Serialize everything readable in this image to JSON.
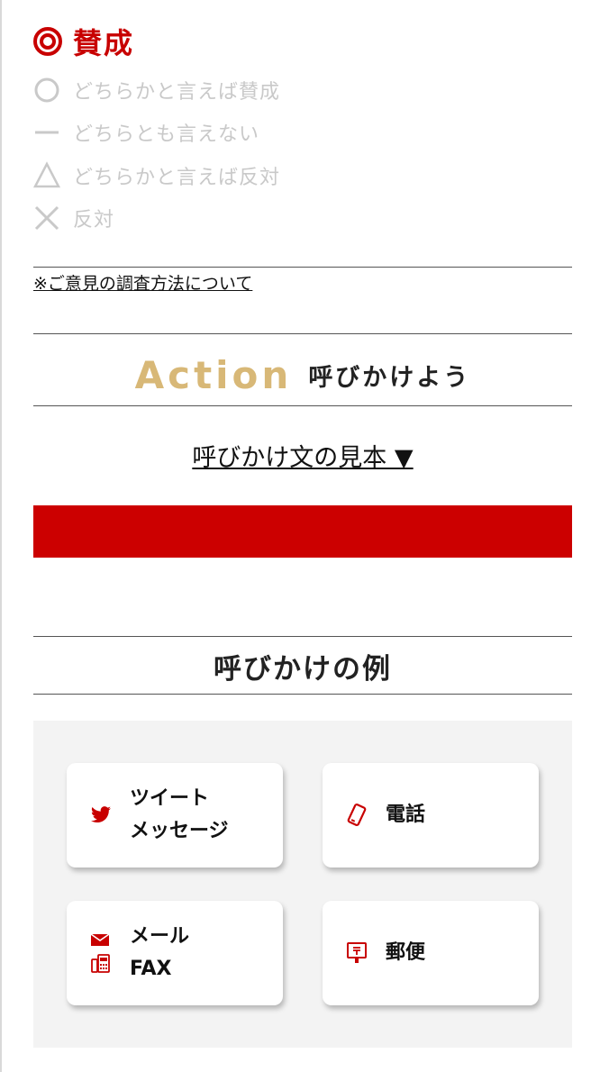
{
  "legend": {
    "strong_agree": "賛成",
    "agree": "どちらかと言えば賛成",
    "neutral": "どちらとも言えない",
    "disagree": "どちらかと言えば反対",
    "strong_disagree": "反対"
  },
  "survey_link": "※ご意見の調査方法について",
  "action": {
    "title_en": "Action",
    "title_jp": "呼びかけよう",
    "sample_link": "呼びかけ文の見本 ▼"
  },
  "examples": {
    "title": "呼びかけの例",
    "cards": [
      {
        "line1": "ツイート",
        "line2": "メッセージ",
        "icon": "twitter-icon"
      },
      {
        "line1": "電話",
        "icon": "phone-icon"
      },
      {
        "line1": "メール",
        "line2": "FAX",
        "icon": "mail-icon",
        "icon2": "fax-icon"
      },
      {
        "line1": "郵便",
        "icon": "postbox-icon"
      }
    ]
  },
  "colors": {
    "accent": "#cc0000",
    "gold": "#d8b877",
    "muted": "#c9c9c9",
    "panel": "#f3f3f3"
  }
}
